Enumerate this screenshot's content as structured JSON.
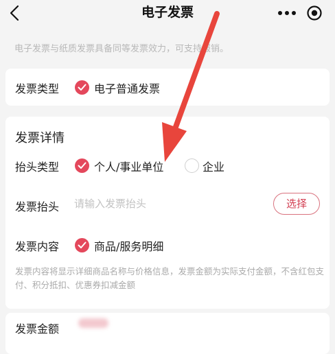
{
  "nav": {
    "title": "电子发票",
    "icons": {
      "back": "chevron-left-icon",
      "more": "more-dots-icon",
      "target": "target-icon"
    }
  },
  "notice": "电子发票与纸质发票具备同等发票效力，可支持报销。",
  "invoice_type": {
    "label": "发票类型",
    "option": "电子普通发票",
    "selected": true
  },
  "detail": {
    "title": "发票详情",
    "header_type": {
      "label": "抬头类型",
      "options": [
        {
          "label": "个人/事业单位",
          "selected": true
        },
        {
          "label": "企业",
          "selected": false
        }
      ]
    },
    "invoice_title": {
      "label": "发票抬头",
      "placeholder": "请输入发票抬头",
      "value": "",
      "select_button": "选择"
    },
    "content": {
      "label": "发票内容",
      "option": "商品/服务明细",
      "selected": true
    },
    "hint": "发票内容将显示详细商品名称与价格信息，发票金额为实际支付金额，不含红包支付、积分抵扣、优惠券扣减金额"
  },
  "amount": {
    "label": "发票金额"
  },
  "colors": {
    "accent": "#e4485c",
    "annotation_arrow": "#e8453c",
    "page_background": "#f4f4f4"
  }
}
